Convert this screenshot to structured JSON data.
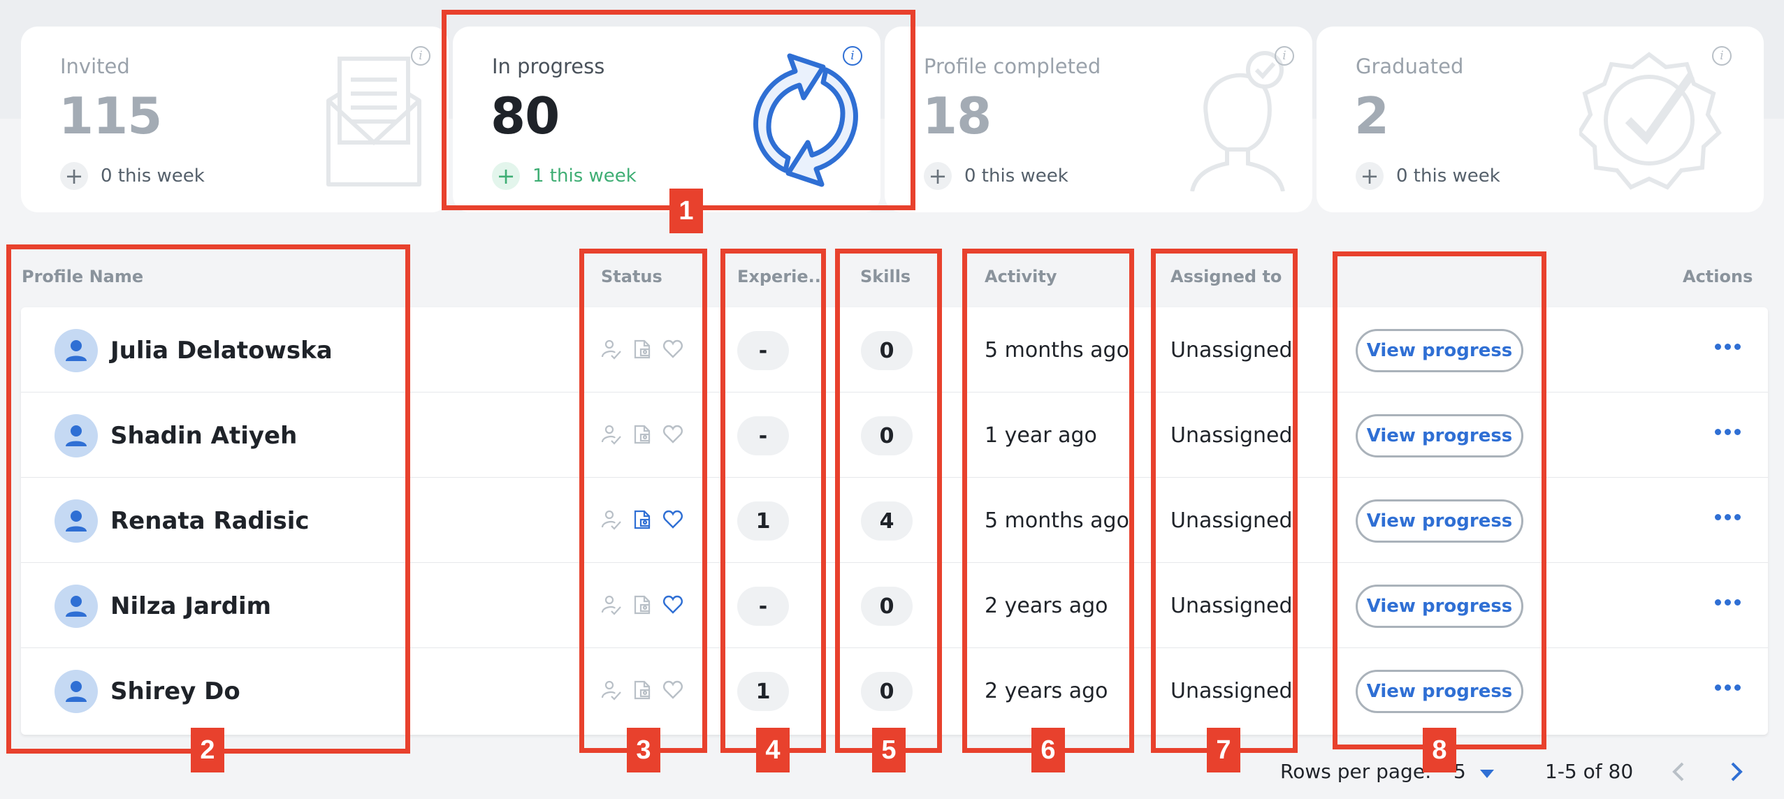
{
  "stages": [
    {
      "label": "Invited",
      "count": "115",
      "week": "0 this week",
      "icon": "envelope-icon",
      "active": false
    },
    {
      "label": "In progress",
      "count": "80",
      "week": "1 this week",
      "icon": "refresh-icon",
      "active": true
    },
    {
      "label": "Profile completed",
      "count": "18",
      "week": "0 this week",
      "icon": "profile-check-icon",
      "active": false
    },
    {
      "label": "Graduated",
      "count": "2",
      "week": "0 this week",
      "icon": "badge-check-icon",
      "active": false
    }
  ],
  "table": {
    "headers": {
      "name": "Profile Name",
      "status": "Status",
      "experience": "Experie...",
      "skills": "Skills",
      "activity": "Activity",
      "assigned": "Assigned to",
      "actions": "Actions"
    },
    "view_label": "View progress",
    "rows": [
      {
        "name": "Julia Delatowska",
        "experience": "-",
        "skills": "0",
        "activity": "5 months ago",
        "assigned": "Unassigned",
        "status_icons": {
          "resume": false,
          "favorite": false
        }
      },
      {
        "name": "Shadin Atiyeh",
        "experience": "-",
        "skills": "0",
        "activity": "1 year ago",
        "assigned": "Unassigned",
        "status_icons": {
          "resume": false,
          "favorite": false
        }
      },
      {
        "name": "Renata Radisic",
        "experience": "1",
        "skills": "4",
        "activity": "5 months ago",
        "assigned": "Unassigned",
        "status_icons": {
          "resume": true,
          "favorite": true
        }
      },
      {
        "name": "Nilza Jardim",
        "experience": "-",
        "skills": "0",
        "activity": "2 years ago",
        "assigned": "Unassigned",
        "status_icons": {
          "resume": false,
          "favorite": true
        }
      },
      {
        "name": "Shirey Do",
        "experience": "1",
        "skills": "0",
        "activity": "2 years ago",
        "assigned": "Unassigned",
        "status_icons": {
          "resume": false,
          "favorite": false
        }
      }
    ]
  },
  "pagination": {
    "rows_label": "Rows per page:",
    "rows_value": "5",
    "range": "1-5 of 80"
  },
  "annotations": [
    "1",
    "2",
    "3",
    "4",
    "5",
    "6",
    "7",
    "8"
  ],
  "colors": {
    "accent": "#2f6fd4",
    "annotation": "#e8412d",
    "positive": "#3fae74",
    "muted": "#a3abb4"
  }
}
